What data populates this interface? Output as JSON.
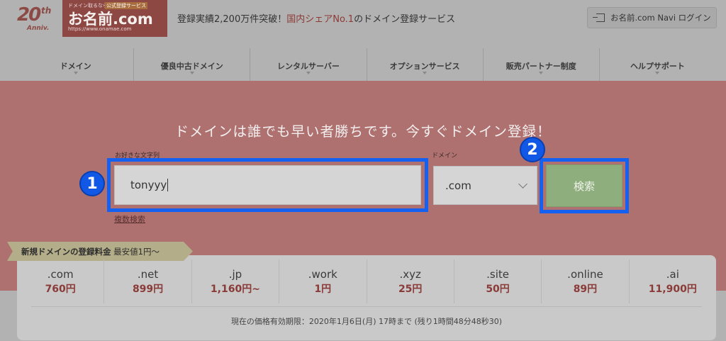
{
  "header": {
    "anniv_num": "20",
    "anniv_th": "th",
    "anniv_sub": "Anniv.",
    "logo_tag1": "ドメイン取るなら",
    "logo_tag2": "公式登録サービス",
    "logo_brand": "お名前.com",
    "logo_url": "https://www.onamae.com",
    "tagline_pre": "登録実績2,200万件突破！",
    "tagline_hl": "国内シェアNo.1",
    "tagline_post": "のドメイン登録サービス",
    "login_label": "お名前.com Navi ログイン"
  },
  "nav": {
    "items": [
      {
        "label": "ドメイン"
      },
      {
        "label": "優良中古ドメイン"
      },
      {
        "label": "レンタルサーバー"
      },
      {
        "label": "オプションサービス"
      },
      {
        "label": "販売パートナー制度"
      },
      {
        "label": "ヘルプサポート"
      }
    ]
  },
  "hero": {
    "headline": "ドメインは誰でも早い者勝ちです。今すぐドメイン登録！",
    "keyword_label": "お好きな文字列",
    "keyword_value": "tonyyy",
    "domain_label": "ドメイン",
    "domain_value": ".com",
    "search_label": "検索",
    "multi_search": "複数検索",
    "badge1": "1",
    "badge2": "2"
  },
  "pricing": {
    "ribbon_bold": "新規ドメインの登録料金",
    "ribbon_rest": "最安値1円〜",
    "items": [
      {
        "tld": ".com",
        "price": "760円"
      },
      {
        "tld": ".net",
        "price": "899円"
      },
      {
        "tld": ".jp",
        "price": "1,160円~"
      },
      {
        "tld": ".work",
        "price": "1円"
      },
      {
        "tld": ".xyz",
        "price": "25円"
      },
      {
        "tld": ".site",
        "price": "50円"
      },
      {
        "tld": ".online",
        "price": "89円"
      },
      {
        "tld": ".ai",
        "price": "11,900円"
      }
    ],
    "validity": "現在の価格有効期限：2020年1月6日(月) 17時まで (残り1時間48分48秒30)"
  },
  "colors": {
    "hero_bg": "#ae7170",
    "highlight_blue": "#1460f0",
    "search_green": "#8fae7d",
    "price_red": "#8a3b38"
  }
}
